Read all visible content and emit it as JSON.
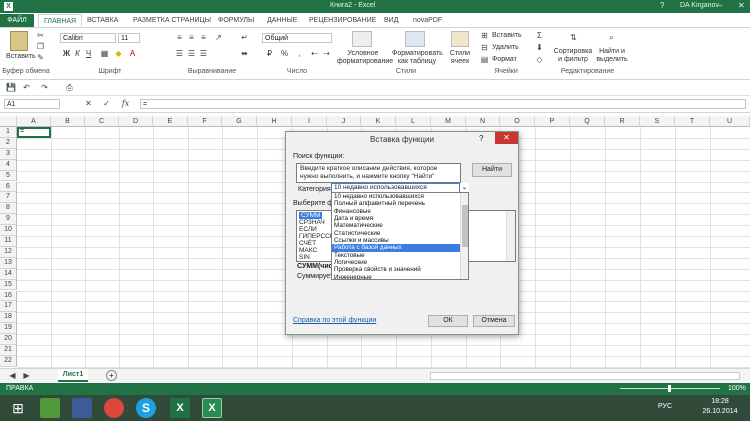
{
  "window": {
    "title": "Книга2 - Excel",
    "user": "DA Kirganov"
  },
  "ribbon_tabs": [
    "ФАЙЛ",
    "ГЛАВНАЯ",
    "ВСТАВКА",
    "РАЗМЕТКА СТРАНИЦЫ",
    "ФОРМУЛЫ",
    "ДАННЫЕ",
    "РЕЦЕНЗИРОВАНИЕ",
    "ВИД",
    "novaPDF"
  ],
  "ribbon": {
    "paste_label": "Вставить",
    "font_name": "Calibri",
    "font_size": "11",
    "number_format": "Общий",
    "cond_format": "Условное форматирование",
    "format_as_table": "Форматировать как таблицу",
    "cell_styles": "Стили ячеек",
    "insert": "Вставить",
    "delete": "Удалить",
    "format": "Формат",
    "sort_filter": "Сортировка и фильтр",
    "find_select": "Найти и выделить",
    "groups": {
      "clipboard": "Буфер обмена",
      "font": "Шрифт",
      "alignment": "Выравнивание",
      "number": "Число",
      "styles": "Стили",
      "cells": "Ячейки",
      "editing": "Редактирование"
    }
  },
  "formula_bar": {
    "name_box": "A1",
    "fx": "fx",
    "value": "="
  },
  "grid": {
    "columns": [
      "A",
      "B",
      "C",
      "D",
      "E",
      "F",
      "G",
      "H",
      "I",
      "J",
      "K",
      "L",
      "M",
      "N",
      "O",
      "P",
      "Q",
      "R",
      "S",
      "T",
      "U"
    ],
    "rows": [
      "1",
      "2",
      "3",
      "4",
      "5",
      "6",
      "7",
      "8",
      "9",
      "10",
      "11",
      "12",
      "13",
      "14",
      "15",
      "16",
      "17",
      "18",
      "19",
      "20",
      "21",
      "22"
    ],
    "a1_value": "="
  },
  "sheet": {
    "tab": "Лист1",
    "add": "+"
  },
  "status": {
    "mode": "ПРАВКА",
    "zoom": "100%"
  },
  "taskbar": {
    "time": "18:28",
    "date": "26.10.2014",
    "lang": "РУС"
  },
  "dialog": {
    "title": "Вставка функции",
    "help": "?",
    "close": "✕",
    "search_label": "Поиск функции:",
    "search_text": "Введите краткое описание действия, которое нужно выполнить, и нажмите кнопку \"Найти\"",
    "find_button": "Найти",
    "category_label": "Категория:",
    "category_value": "10 недавно использовавшихся",
    "choose_label": "Выберите ф",
    "function_list": [
      "СУММ",
      "СРЗНАЧ",
      "ЕСЛИ",
      "ГИПЕРССЫ",
      "СЧЁТ",
      "МАКС",
      "SIN"
    ],
    "func_signature": "СУММ(чис",
    "func_desc": "Суммирует",
    "help_link": "Справка по этой функции",
    "ok": "ОК",
    "cancel": "Отмена",
    "dropdown_items": [
      "10 недавно использовавшихся",
      "Полный алфавитный перечень",
      "Финансовые",
      "Дата и время",
      "Математические",
      "Статистические",
      "Ссылки и массивы",
      "Работа с базой данных",
      "Текстовые",
      "Логические",
      "Проверка свойств и значений",
      "Инженерные"
    ],
    "dropdown_selected": 7
  },
  "colors": {
    "accent": "#217346",
    "selection": "#3b7ee0",
    "close": "#c7372f"
  }
}
